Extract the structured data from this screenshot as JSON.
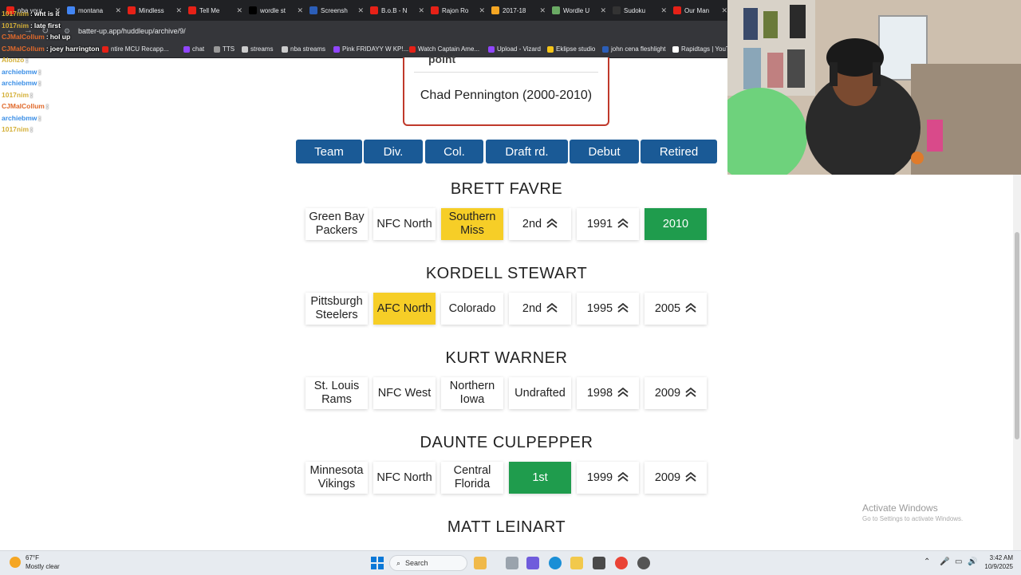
{
  "browser": {
    "tabs": [
      {
        "label": "nba your",
        "color": "#e62117"
      },
      {
        "label": "montana",
        "color": "#4285f4"
      },
      {
        "label": "Mindless",
        "color": "#e62117"
      },
      {
        "label": "Tell Me",
        "color": "#e62117"
      },
      {
        "label": "wordle st",
        "color": "#000000"
      },
      {
        "label": "Screensh",
        "color": "#2b5eb8"
      },
      {
        "label": "B.o.B - N",
        "color": "#e62117"
      },
      {
        "label": "Rajon Ro",
        "color": "#e62117"
      },
      {
        "label": "2017-18",
        "color": "#f5a623"
      },
      {
        "label": "Wordle U",
        "color": "#6aaa64"
      },
      {
        "label": "Sudoku",
        "color": "#333333"
      },
      {
        "label": "Our Man",
        "color": "#e62117"
      }
    ],
    "url": "batter-up.app/huddleup/archive/9/",
    "bookmarks": [
      {
        "label": "ntire MCU Recapp...",
        "color": "#e62117"
      },
      {
        "label": "chat",
        "color": "#9146ff"
      },
      {
        "label": "TTS",
        "color": "#999999"
      },
      {
        "label": "streams",
        "color": "#cccccc"
      },
      {
        "label": "nba streams",
        "color": "#cccccc"
      },
      {
        "label": "Pink FRIDAYY W KP!...",
        "color": "#9146ff"
      },
      {
        "label": "Watch Captain Ame...",
        "color": "#e62117"
      },
      {
        "label": "Upload - Vizard",
        "color": "#9146ff"
      },
      {
        "label": "Eklipse studio",
        "color": "#f5c518"
      },
      {
        "label": "john cena fleshlight",
        "color": "#2b5eb8"
      },
      {
        "label": "Rapidtags | YouT",
        "color": "#ffffff"
      }
    ]
  },
  "chat": [
    {
      "user": "1017nim",
      "msg": "wht is it",
      "color": "#d4af37",
      "faded": false
    },
    {
      "user": "1017nim",
      "msg": "late first",
      "color": "#d4af37",
      "faded": false
    },
    {
      "user": "CJMalCollum",
      "msg": "hol up",
      "color": "#e0692b",
      "faded": false
    },
    {
      "user": "CJMalCollum",
      "msg": "joey harrington",
      "color": "#e0692b",
      "faded": false
    },
    {
      "user": "Alonzo",
      "msg": "",
      "color": "#d4af37",
      "faded": true
    },
    {
      "user": "archiebmw",
      "msg": "",
      "color": "#3a8ee6",
      "faded": true
    },
    {
      "user": "archiebmw",
      "msg": "",
      "color": "#3a8ee6",
      "faded": true
    },
    {
      "user": "1017nim",
      "msg": "",
      "color": "#d4af37",
      "faded": true
    },
    {
      "user": "CJMalCollum",
      "msg": "",
      "color": "#e0692b",
      "faded": true
    },
    {
      "user": "archiebmw",
      "msg": "",
      "color": "#3a8ee6",
      "faded": true
    },
    {
      "user": "1017nim",
      "msg": "",
      "color": "#d4af37",
      "faded": true
    }
  ],
  "answer": {
    "label": "point",
    "name": "Chad Pennington (2000-2010)"
  },
  "headers": [
    "Team",
    "Div.",
    "Col.",
    "Draft rd.",
    "Debut",
    "Retired"
  ],
  "guesses": [
    {
      "player": "BRETT FAVRE",
      "cells": [
        {
          "text": "Green Bay Packers",
          "state": "none",
          "arrow": ""
        },
        {
          "text": "NFC North",
          "state": "none",
          "arrow": ""
        },
        {
          "text": "Southern Miss",
          "state": "yellow",
          "arrow": ""
        },
        {
          "text": "2nd",
          "state": "none",
          "arrow": "up"
        },
        {
          "text": "1991",
          "state": "none",
          "arrow": "up"
        },
        {
          "text": "2010",
          "state": "green",
          "arrow": ""
        }
      ]
    },
    {
      "player": "KORDELL STEWART",
      "cells": [
        {
          "text": "Pittsburgh Steelers",
          "state": "none",
          "arrow": ""
        },
        {
          "text": "AFC North",
          "state": "yellow",
          "arrow": ""
        },
        {
          "text": "Colorado",
          "state": "none",
          "arrow": ""
        },
        {
          "text": "2nd",
          "state": "none",
          "arrow": "up"
        },
        {
          "text": "1995",
          "state": "none",
          "arrow": "up"
        },
        {
          "text": "2005",
          "state": "none",
          "arrow": "up"
        }
      ]
    },
    {
      "player": "KURT WARNER",
      "cells": [
        {
          "text": "St. Louis Rams",
          "state": "none",
          "arrow": ""
        },
        {
          "text": "NFC West",
          "state": "none",
          "arrow": ""
        },
        {
          "text": "Northern Iowa",
          "state": "none",
          "arrow": ""
        },
        {
          "text": "Undrafted",
          "state": "none",
          "arrow": ""
        },
        {
          "text": "1998",
          "state": "none",
          "arrow": "up"
        },
        {
          "text": "2009",
          "state": "none",
          "arrow": "up"
        }
      ]
    },
    {
      "player": "DAUNTE CULPEPPER",
      "cells": [
        {
          "text": "Minnesota Vikings",
          "state": "none",
          "arrow": ""
        },
        {
          "text": "NFC North",
          "state": "none",
          "arrow": ""
        },
        {
          "text": "Central Florida",
          "state": "none",
          "arrow": ""
        },
        {
          "text": "1st",
          "state": "green",
          "arrow": ""
        },
        {
          "text": "1999",
          "state": "none",
          "arrow": "up"
        },
        {
          "text": "2009",
          "state": "none",
          "arrow": "up"
        }
      ]
    },
    {
      "player": "MATT LEINART",
      "cells": []
    }
  ],
  "colors": {
    "header": "#1a5a96",
    "yellow": "#f6ce27",
    "green": "#1f9c4d",
    "answer_border": "#c0392b"
  },
  "watermark": {
    "title": "Activate Windows",
    "subtitle": "Go to Settings to activate Windows."
  },
  "taskbar": {
    "weather_temp": "67°F",
    "weather_desc": "Mostly clear",
    "search": "Search",
    "time": "3:42 AM",
    "date": "10/9/2025"
  }
}
